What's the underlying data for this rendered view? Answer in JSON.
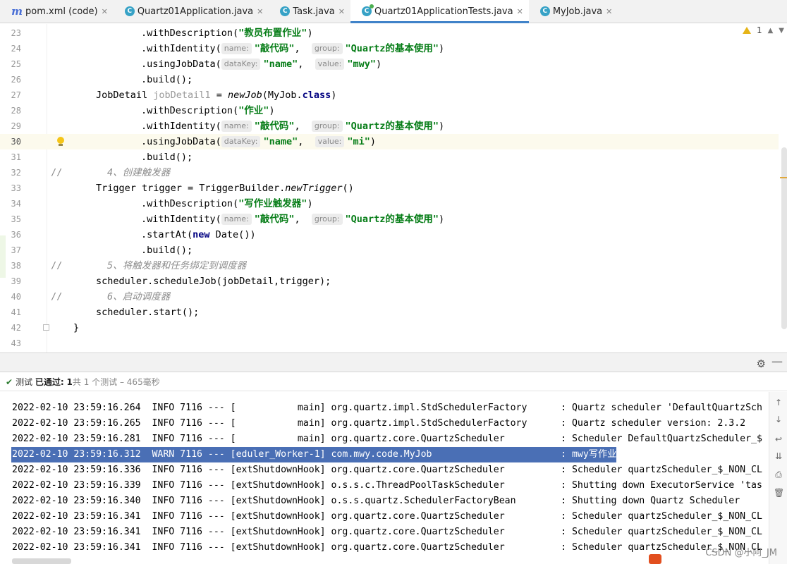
{
  "tabs": [
    {
      "icon": "maven-icon",
      "label": "pom.xml (code)",
      "active": false
    },
    {
      "icon": "class-icon",
      "label": "Quartz01Application.java",
      "active": false
    },
    {
      "icon": "class-icon",
      "label": "Task.java",
      "active": false
    },
    {
      "icon": "test-class-icon",
      "label": "Quartz01ApplicationTests.java",
      "active": true
    },
    {
      "icon": "class-icon",
      "label": "MyJob.java",
      "active": false
    }
  ],
  "editor": {
    "warnings": {
      "count": "1"
    },
    "lines": [
      {
        "num": "23"
      },
      {
        "num": "24"
      },
      {
        "num": "25"
      },
      {
        "num": "26"
      },
      {
        "num": "27"
      },
      {
        "num": "28"
      },
      {
        "num": "29"
      },
      {
        "num": "30"
      },
      {
        "num": "31"
      },
      {
        "num": "32"
      },
      {
        "num": "33"
      },
      {
        "num": "34"
      },
      {
        "num": "35"
      },
      {
        "num": "36"
      },
      {
        "num": "37"
      },
      {
        "num": "38"
      },
      {
        "num": "39"
      },
      {
        "num": "40"
      },
      {
        "num": "41"
      },
      {
        "num": "42"
      },
      {
        "num": "43"
      }
    ],
    "code": {
      "withDescription_1": "\"教员布置作业\"",
      "name_hint": "name:",
      "group_hint": "group:",
      "datakey_hint": "dataKey:",
      "value_hint": "value:",
      "identity_name": "\"敲代码\"",
      "identity_group": "\"Quartz的基本使用\"",
      "data_key": "\"name\"",
      "data_value_1": "\"mwy\"",
      "jobdetail_var": "jobDetail1",
      "withDescription_2": "\"作业\"",
      "data_value_2": "\"mi\"",
      "comment_4": "4、创建触发器",
      "withDescription_3": "\"写作业触发器\"",
      "comment_5": "5、将触发器和任务绑定到调度器",
      "comment_6": "6、启动调度器"
    }
  },
  "test_status": {
    "label": "测试",
    "passed": "已通过:",
    "count": "1",
    "total": "共 1 个测试 – 465毫秒"
  },
  "console": {
    "lines": [
      "2022-02-10 23:59:16.264  INFO 7116 --- [           main] org.quartz.impl.StdSchedulerFactory      : Quartz scheduler 'DefaultQuartzSch",
      "2022-02-10 23:59:16.265  INFO 7116 --- [           main] org.quartz.impl.StdSchedulerFactory      : Quartz scheduler version: 2.3.2",
      "2022-02-10 23:59:16.281  INFO 7116 --- [           main] org.quartz.core.QuartzScheduler          : Scheduler DefaultQuartzScheduler_$",
      "2022-02-10 23:59:16.312  WARN 7116 --- [eduler_Worker-1] com.mwy.code.MyJob                       : mwy写作业",
      "2022-02-10 23:59:16.336  INFO 7116 --- [extShutdownHook] org.quartz.core.QuartzScheduler          : Scheduler quartzScheduler_$_NON_CL",
      "2022-02-10 23:59:16.339  INFO 7116 --- [extShutdownHook] o.s.s.c.ThreadPoolTaskScheduler          : Shutting down ExecutorService 'tas",
      "2022-02-10 23:59:16.340  INFO 7116 --- [extShutdownHook] o.s.s.quartz.SchedulerFactoryBean        : Shutting down Quartz Scheduler",
      "2022-02-10 23:59:16.341  INFO 7116 --- [extShutdownHook] org.quartz.core.QuartzScheduler          : Scheduler quartzScheduler_$_NON_CL",
      "2022-02-10 23:59:16.341  INFO 7116 --- [extShutdownHook] org.quartz.core.QuartzScheduler          : Scheduler quartzScheduler_$_NON_CL",
      "2022-02-10 23:59:16.341  INFO 7116 --- [extShutdownHook] org.quartz.core.QuartzScheduler          : Scheduler quartzScheduler_$_NON_CL"
    ],
    "selected_index": 3
  },
  "watermark": "CSDN @小阿_JM",
  "colors": {
    "accent": "#4083c9",
    "selection": "#4a6fb5",
    "string": "#067d17",
    "keyword": "#000080"
  }
}
